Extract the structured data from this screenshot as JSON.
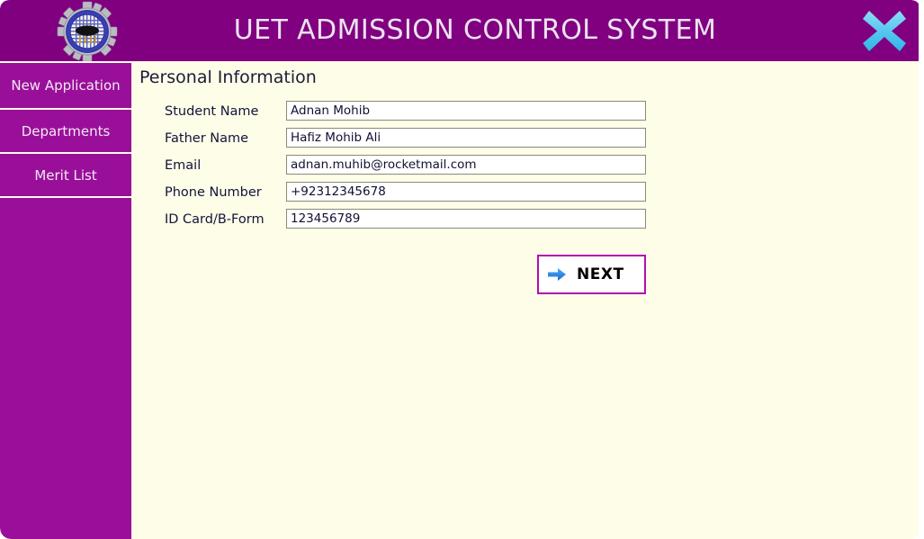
{
  "window": {
    "title": "UET ADMISSION CONTROL SYSTEM",
    "close_icon": "close-x-icon",
    "logo_icon": "uet-department-gear-logo",
    "logo_ring_text": "DEPARTMENT OF COMPUTER SCIENCE & ENGINEERING",
    "colors": {
      "header_purple": "#800080",
      "sidebar_purple": "#9a0f9a",
      "content_cream": "#fdfde8",
      "close_icon_blue": "#4ec3ee",
      "accent_magenta": "#b010b0",
      "arrow_blue": "#1e90ff",
      "title_text": "#ece3f0"
    }
  },
  "sidebar": {
    "items": [
      {
        "label": "New Application"
      },
      {
        "label": "Departments"
      },
      {
        "label": "Merit List"
      }
    ]
  },
  "main": {
    "heading": "Personal Information",
    "fields": [
      {
        "label": "Student Name",
        "value": "Adnan Mohib"
      },
      {
        "label": "Father Name",
        "value": "Hafiz Mohib Ali"
      },
      {
        "label": "Email",
        "value": "adnan.muhib@rocketmail.com"
      },
      {
        "label": "Phone Number",
        "value": "+92312345678"
      },
      {
        "label": "ID Card/B-Form",
        "value": "123456789"
      }
    ],
    "next_button": {
      "label": "NEXT",
      "icon": "arrow-right-icon"
    }
  }
}
